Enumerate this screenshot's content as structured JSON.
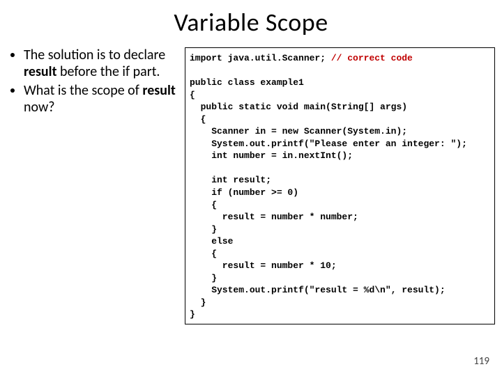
{
  "title": "Variable Scope",
  "bullets": [
    {
      "pre": "The solution is to declare ",
      "bold": "result",
      "post": " before the if part."
    },
    {
      "pre": "What is the scope of ",
      "bold": "result",
      "post": " now?"
    }
  ],
  "code": {
    "l01a": "import java.util.Scanner; ",
    "l01b": "// correct code",
    "l02": "",
    "l03": "public class example1",
    "l04": "{",
    "l05": "  public static void main(String[] args)",
    "l06": "  {",
    "l07": "    Scanner in = new Scanner(System.in);",
    "l08": "    System.out.printf(\"Please enter an integer: \");",
    "l09": "    int number = in.nextInt();",
    "l10": "",
    "l11": "    int result;",
    "l12": "    if (number >= 0)",
    "l13": "    {",
    "l14": "      result = number * number;",
    "l15": "    }",
    "l16": "    else",
    "l17": "    {",
    "l18": "      result = number * 10;",
    "l19": "    }",
    "l20": "    System.out.printf(\"result = %d\\n\", result);",
    "l21": "  }",
    "l22": "}"
  },
  "slide_number": "119"
}
